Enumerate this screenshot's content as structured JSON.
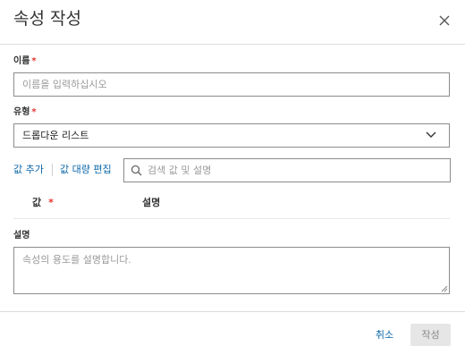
{
  "dialog": {
    "title": "속성 작성"
  },
  "form": {
    "name_label": "이름",
    "name_placeholder": "이름을 입력하십시오",
    "type_label": "유형",
    "type_value": "드롭다운 리스트",
    "required_mark": "*"
  },
  "values_toolbar": {
    "add_value_label": "값 추가",
    "bulk_edit_label": "값 대량 편집",
    "search_placeholder": "검색 값 및 설명"
  },
  "values_table": {
    "columns": [
      "값",
      "설명"
    ]
  },
  "description": {
    "label": "설명",
    "placeholder": "속성의 용도를 설명합니다."
  },
  "footer": {
    "cancel_label": "취소",
    "create_label": "작성"
  },
  "colors": {
    "link": "#0a66a8",
    "required": "#e3342f",
    "disabled_button_bg": "#e6e6e6",
    "border": "#8c8c8c"
  },
  "icons": [
    "close-icon",
    "chevron-down-icon",
    "search-icon",
    "resize-grip-icon"
  ]
}
